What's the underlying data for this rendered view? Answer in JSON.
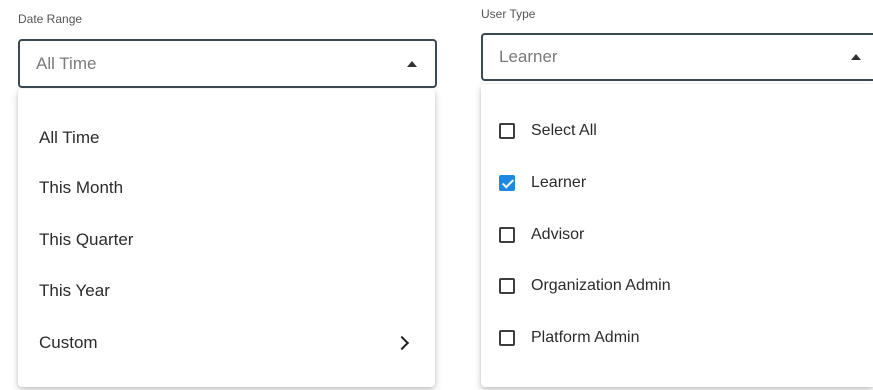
{
  "date_range": {
    "label": "Date Range",
    "selected": "All Time",
    "options": [
      "All Time",
      "This Month",
      "This Quarter",
      "This Year",
      "Custom"
    ]
  },
  "user_type": {
    "label": "User Type",
    "selected": "Learner",
    "options": [
      {
        "label": "Select All",
        "checked": false
      },
      {
        "label": "Learner",
        "checked": true
      },
      {
        "label": "Advisor",
        "checked": false
      },
      {
        "label": "Organization Admin",
        "checked": false
      },
      {
        "label": "Platform Admin",
        "checked": false
      }
    ]
  },
  "colors": {
    "checkbox_checked": "#1e88e5",
    "select_border": "#3a4a52"
  },
  "icons": {
    "select_caret": "caret-up-icon",
    "submenu": "chevron-right-icon",
    "checked": "check-icon"
  }
}
